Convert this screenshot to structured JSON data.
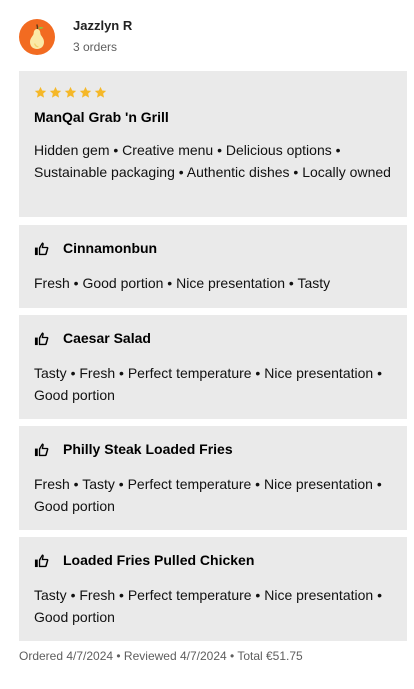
{
  "user": {
    "name": "Jazzlyn R",
    "orders": "3 orders",
    "avatar_icon": "pear-icon",
    "avatar_color": "#F26B21"
  },
  "restaurant_review": {
    "rating": 5,
    "max_rating": 5,
    "star_color": "#F5B829",
    "name": "ManQal Grab 'n Grill",
    "tags": "Hidden gem • Creative menu • Delicious options • Sustainable packaging • Authentic dishes • Locally owned"
  },
  "items": [
    {
      "icon": "thumbs-up-icon",
      "name": "Cinnamonbun",
      "tags": "Fresh • Good portion • Nice presentation • Tasty"
    },
    {
      "icon": "thumbs-up-icon",
      "name": "Caesar Salad",
      "tags": "Tasty • Fresh • Perfect temperature • Nice presentation • Good portion"
    },
    {
      "icon": "thumbs-up-icon",
      "name": "Philly Steak Loaded Fries",
      "tags": "Fresh • Tasty • Perfect temperature • Nice presentation • Good portion"
    },
    {
      "icon": "thumbs-up-icon",
      "name": "Loaded Fries Pulled Chicken",
      "tags": "Tasty • Fresh • Perfect temperature • Nice presentation • Good portion"
    }
  ],
  "footer": {
    "text": "Ordered 4/7/2024 • Reviewed 4/7/2024 • Total €51.75"
  },
  "colors": {
    "card_background": "#EAEAEA",
    "secondary_text": "#5E5E5E"
  }
}
